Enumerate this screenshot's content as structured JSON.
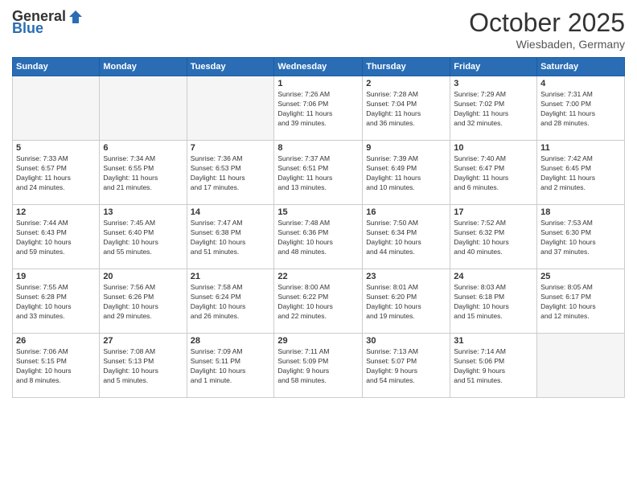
{
  "header": {
    "logo_general": "General",
    "logo_blue": "Blue",
    "title": "October 2025",
    "location": "Wiesbaden, Germany"
  },
  "weekdays": [
    "Sunday",
    "Monday",
    "Tuesday",
    "Wednesday",
    "Thursday",
    "Friday",
    "Saturday"
  ],
  "weeks": [
    [
      {
        "day": "",
        "info": ""
      },
      {
        "day": "",
        "info": ""
      },
      {
        "day": "",
        "info": ""
      },
      {
        "day": "1",
        "info": "Sunrise: 7:26 AM\nSunset: 7:06 PM\nDaylight: 11 hours\nand 39 minutes."
      },
      {
        "day": "2",
        "info": "Sunrise: 7:28 AM\nSunset: 7:04 PM\nDaylight: 11 hours\nand 36 minutes."
      },
      {
        "day": "3",
        "info": "Sunrise: 7:29 AM\nSunset: 7:02 PM\nDaylight: 11 hours\nand 32 minutes."
      },
      {
        "day": "4",
        "info": "Sunrise: 7:31 AM\nSunset: 7:00 PM\nDaylight: 11 hours\nand 28 minutes."
      }
    ],
    [
      {
        "day": "5",
        "info": "Sunrise: 7:33 AM\nSunset: 6:57 PM\nDaylight: 11 hours\nand 24 minutes."
      },
      {
        "day": "6",
        "info": "Sunrise: 7:34 AM\nSunset: 6:55 PM\nDaylight: 11 hours\nand 21 minutes."
      },
      {
        "day": "7",
        "info": "Sunrise: 7:36 AM\nSunset: 6:53 PM\nDaylight: 11 hours\nand 17 minutes."
      },
      {
        "day": "8",
        "info": "Sunrise: 7:37 AM\nSunset: 6:51 PM\nDaylight: 11 hours\nand 13 minutes."
      },
      {
        "day": "9",
        "info": "Sunrise: 7:39 AM\nSunset: 6:49 PM\nDaylight: 11 hours\nand 10 minutes."
      },
      {
        "day": "10",
        "info": "Sunrise: 7:40 AM\nSunset: 6:47 PM\nDaylight: 11 hours\nand 6 minutes."
      },
      {
        "day": "11",
        "info": "Sunrise: 7:42 AM\nSunset: 6:45 PM\nDaylight: 11 hours\nand 2 minutes."
      }
    ],
    [
      {
        "day": "12",
        "info": "Sunrise: 7:44 AM\nSunset: 6:43 PM\nDaylight: 10 hours\nand 59 minutes."
      },
      {
        "day": "13",
        "info": "Sunrise: 7:45 AM\nSunset: 6:40 PM\nDaylight: 10 hours\nand 55 minutes."
      },
      {
        "day": "14",
        "info": "Sunrise: 7:47 AM\nSunset: 6:38 PM\nDaylight: 10 hours\nand 51 minutes."
      },
      {
        "day": "15",
        "info": "Sunrise: 7:48 AM\nSunset: 6:36 PM\nDaylight: 10 hours\nand 48 minutes."
      },
      {
        "day": "16",
        "info": "Sunrise: 7:50 AM\nSunset: 6:34 PM\nDaylight: 10 hours\nand 44 minutes."
      },
      {
        "day": "17",
        "info": "Sunrise: 7:52 AM\nSunset: 6:32 PM\nDaylight: 10 hours\nand 40 minutes."
      },
      {
        "day": "18",
        "info": "Sunrise: 7:53 AM\nSunset: 6:30 PM\nDaylight: 10 hours\nand 37 minutes."
      }
    ],
    [
      {
        "day": "19",
        "info": "Sunrise: 7:55 AM\nSunset: 6:28 PM\nDaylight: 10 hours\nand 33 minutes."
      },
      {
        "day": "20",
        "info": "Sunrise: 7:56 AM\nSunset: 6:26 PM\nDaylight: 10 hours\nand 29 minutes."
      },
      {
        "day": "21",
        "info": "Sunrise: 7:58 AM\nSunset: 6:24 PM\nDaylight: 10 hours\nand 26 minutes."
      },
      {
        "day": "22",
        "info": "Sunrise: 8:00 AM\nSunset: 6:22 PM\nDaylight: 10 hours\nand 22 minutes."
      },
      {
        "day": "23",
        "info": "Sunrise: 8:01 AM\nSunset: 6:20 PM\nDaylight: 10 hours\nand 19 minutes."
      },
      {
        "day": "24",
        "info": "Sunrise: 8:03 AM\nSunset: 6:18 PM\nDaylight: 10 hours\nand 15 minutes."
      },
      {
        "day": "25",
        "info": "Sunrise: 8:05 AM\nSunset: 6:17 PM\nDaylight: 10 hours\nand 12 minutes."
      }
    ],
    [
      {
        "day": "26",
        "info": "Sunrise: 7:06 AM\nSunset: 5:15 PM\nDaylight: 10 hours\nand 8 minutes."
      },
      {
        "day": "27",
        "info": "Sunrise: 7:08 AM\nSunset: 5:13 PM\nDaylight: 10 hours\nand 5 minutes."
      },
      {
        "day": "28",
        "info": "Sunrise: 7:09 AM\nSunset: 5:11 PM\nDaylight: 10 hours\nand 1 minute."
      },
      {
        "day": "29",
        "info": "Sunrise: 7:11 AM\nSunset: 5:09 PM\nDaylight: 9 hours\nand 58 minutes."
      },
      {
        "day": "30",
        "info": "Sunrise: 7:13 AM\nSunset: 5:07 PM\nDaylight: 9 hours\nand 54 minutes."
      },
      {
        "day": "31",
        "info": "Sunrise: 7:14 AM\nSunset: 5:06 PM\nDaylight: 9 hours\nand 51 minutes."
      },
      {
        "day": "",
        "info": ""
      }
    ]
  ]
}
